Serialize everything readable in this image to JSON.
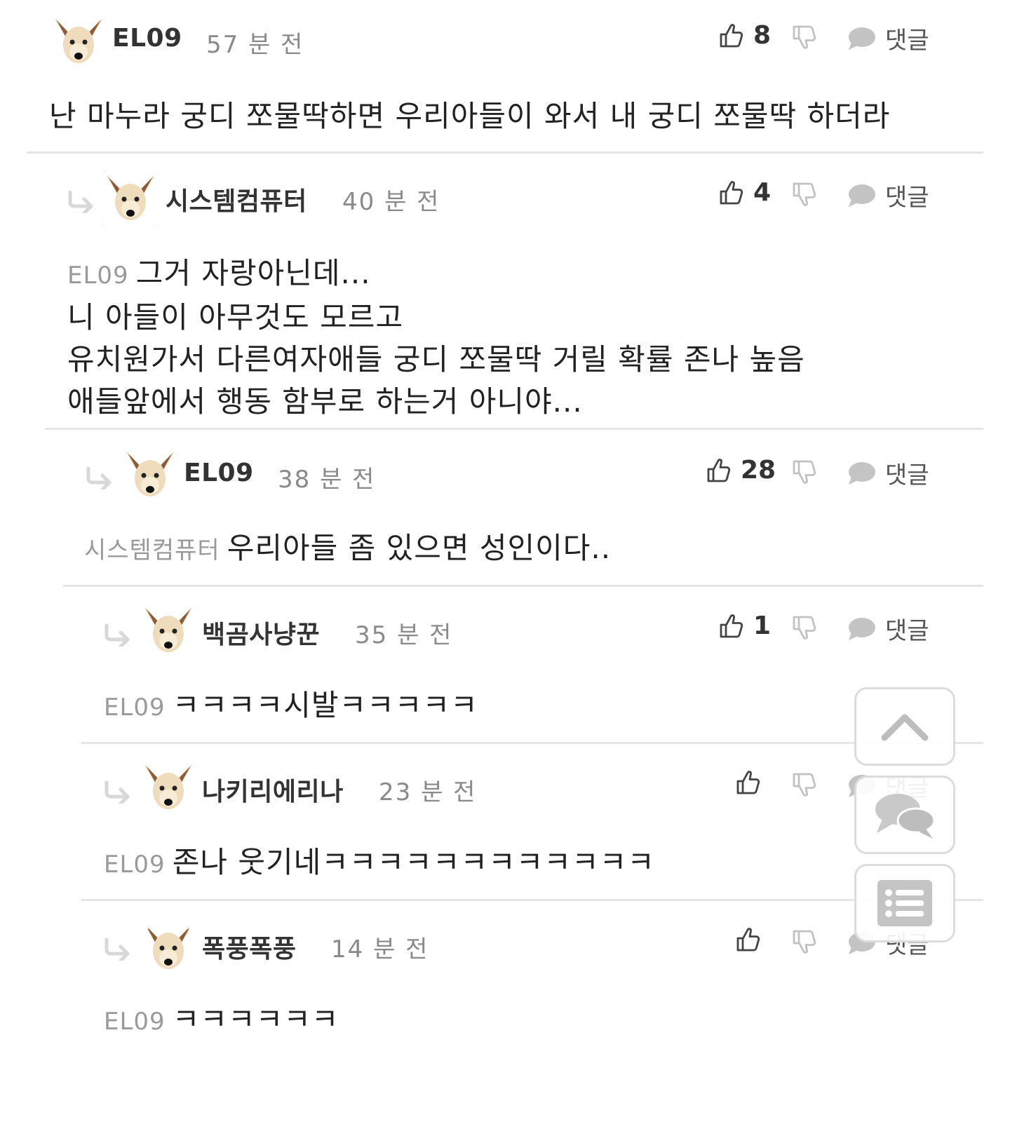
{
  "comments": [
    {
      "username": "EL09",
      "time": "57 분 전",
      "likes": "8",
      "reply_label": "댓글",
      "mention": "",
      "lines": [
        "난 마누라 궁디 쪼물딱하면 우리아들이 와서 내 궁디 쪼물딱 하더라"
      ]
    },
    {
      "username": "시스템컴퓨터",
      "time": "40 분 전",
      "likes": "4",
      "reply_label": "댓글",
      "mention": "EL09",
      "lines": [
        "그거 자랑아닌데...",
        "니 아들이 아무것도 모르고",
        "유치원가서 다른여자애들 궁디 쪼물딱 거릴 확률 존나 높음",
        "애들앞에서 행동 함부로 하는거 아니야..."
      ]
    },
    {
      "username": "EL09",
      "time": "38 분 전",
      "likes": "28",
      "reply_label": "댓글",
      "mention": "시스템컴퓨터",
      "lines": [
        "우리아들 좀 있으면 성인이다.."
      ]
    },
    {
      "username": "백곰사냥꾼",
      "time": "35 분 전",
      "likes": "1",
      "reply_label": "댓글",
      "mention": "EL09",
      "lines": [
        "ㅋㅋㅋㅋ시발ㅋㅋㅋㅋㅋ"
      ]
    },
    {
      "username": "나키리에리나",
      "time": "23 분 전",
      "likes": "",
      "reply_label": "댓글",
      "mention": "EL09",
      "lines": [
        "존나 웃기네ㅋㅋㅋㅋㅋㅋㅋㅋㅋㅋㅋㅋ"
      ]
    },
    {
      "username": "폭풍폭풍",
      "time": "14 분 전",
      "likes": "",
      "reply_label": "댓글",
      "mention": "EL09",
      "lines": [
        "ㅋㅋㅋㅋㅋㅋ"
      ]
    }
  ],
  "floating_buttons": {
    "top_icon": "chevron-up-icon",
    "comments_icon": "comments-icon",
    "list_icon": "list-icon"
  },
  "colors": {
    "divider": "#e6e6e6",
    "muted_text": "#8a8a8a",
    "icon": "#bdbdbd",
    "icon_dark": "#444444"
  }
}
